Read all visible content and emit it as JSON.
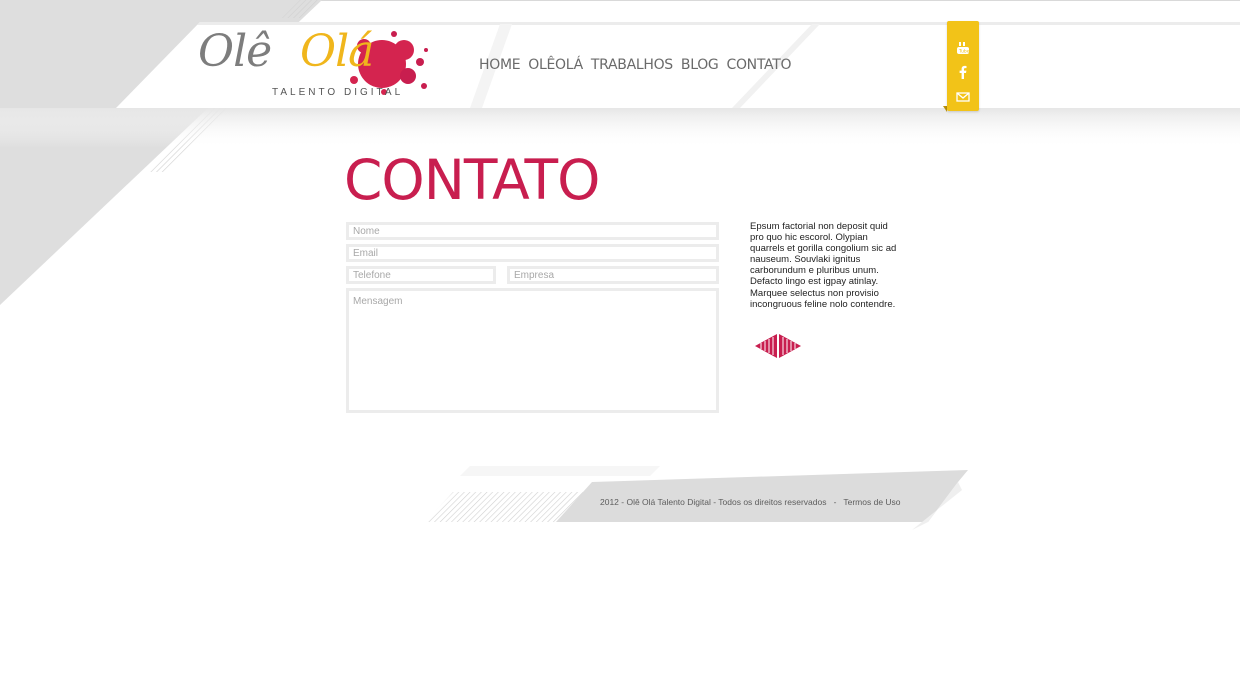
{
  "logo": {
    "word1": "Olê",
    "word2": "Olá",
    "tagline": "TALENTO DIGITAL"
  },
  "nav": [
    "HOME",
    "OLÊOLÁ",
    "TRABALHOS",
    "BLOG",
    "CONTATO"
  ],
  "social": [
    "youtube-icon",
    "facebook-icon",
    "email-icon"
  ],
  "page_title": "CONTATO",
  "form": {
    "nome": "Nome",
    "email": "Email",
    "telefone": "Telefone",
    "empresa": "Empresa",
    "mensagem": "Mensagem"
  },
  "side_text": "Epsum factorial non deposit quid pro quo hic escorol. Olypian quarrels et gorilla congolium sic ad nauseum. Souvlaki ignitus carborundum e pluribus unum. Defacto lingo est igpay atinlay. Marquee selectus non provisio incongruous feline nolo contendre.",
  "footer": {
    "copyright": "2012 - Olê Olá Talento Digital - Todos os direitos reservados",
    "separator": "-",
    "terms": "Termos de Uso"
  },
  "colors": {
    "accent": "#c81e4f",
    "yellow": "#f2c318",
    "gray": "#dcdcdc"
  }
}
